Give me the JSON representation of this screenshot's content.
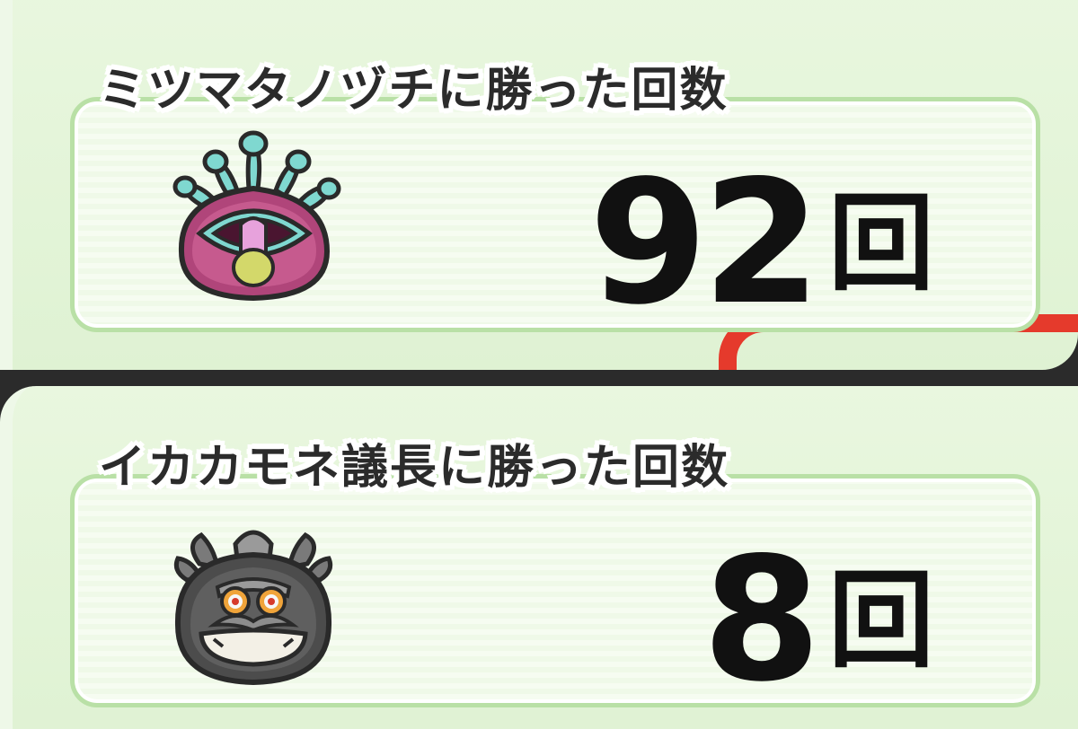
{
  "records": [
    {
      "title": "ミツマタノヅチに勝った回数",
      "count": "92",
      "unit": "回",
      "icon": "mitsumatanozuchi-icon"
    },
    {
      "title": "イカカモネ議長に勝った回数",
      "count": "8",
      "unit": "回",
      "icon": "ikakamone-chairman-icon"
    }
  ],
  "colors": {
    "panel_bg": "#e4f5d8",
    "card_border": "#b9e0a6",
    "accent_red": "#e53a2c",
    "text": "#111111"
  }
}
